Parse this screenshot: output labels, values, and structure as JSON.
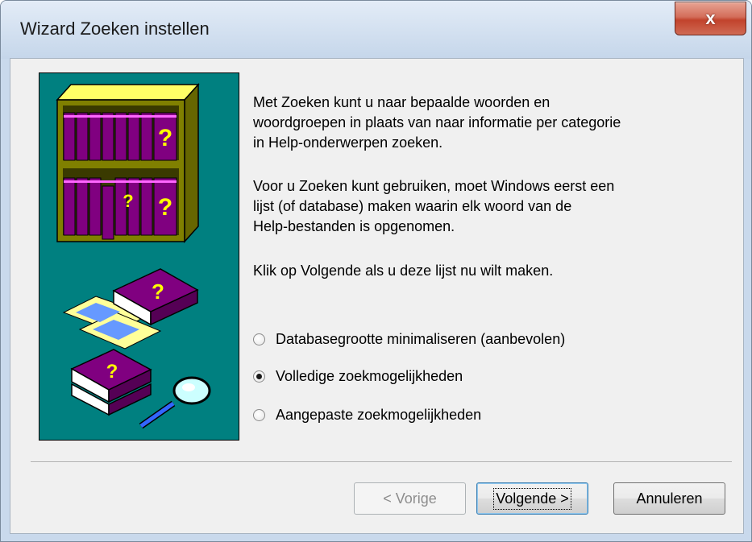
{
  "window": {
    "title": "Wizard Zoeken instellen",
    "close_label": "x"
  },
  "content": {
    "paragraph_1": "Met Zoeken kunt u naar bepaalde woorden en\nwoordgroepen in plaats van naar informatie per categorie\nin Help-onderwerpen zoeken.",
    "paragraph_2": "Voor u Zoeken kunt gebruiken, moet Windows eerst een\nlijst (of database) maken waarin elk woord van de\nHelp-bestanden is opgenomen.",
    "paragraph_3": "Klik op Volgende als u deze lijst nu wilt maken."
  },
  "options": [
    {
      "label": "Databasegrootte minimaliseren (aanbevolen)",
      "checked": false
    },
    {
      "label": "Volledige zoekmogelijkheden",
      "checked": true
    },
    {
      "label": "Aangepaste zoekmogelijkheden",
      "checked": false
    }
  ],
  "buttons": {
    "back": "< Vorige",
    "next": "Volgende >",
    "cancel": "Annuleren"
  },
  "illustration": {
    "question_mark": "?"
  },
  "colors": {
    "panel_bg": "#008080",
    "book_purple": "#800080",
    "shelf_olive": "#808000",
    "close_red": "#c2432c"
  }
}
